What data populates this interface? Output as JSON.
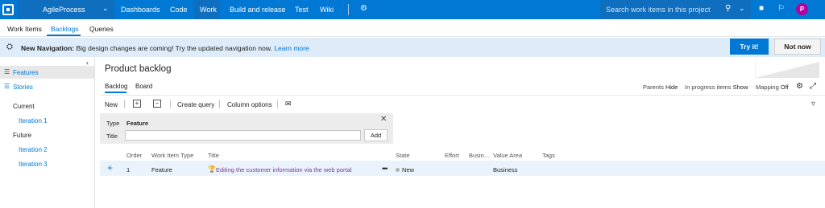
{
  "topbar": {
    "project": "AgileProcess",
    "nav": [
      "Dashboards",
      "Code",
      "Work",
      "Build and release",
      "Test",
      "Wiki"
    ],
    "active_nav": "Work",
    "search_placeholder": "Search work items in this project",
    "avatar_initial": "P",
    "colors": {
      "bar": "#0078d4",
      "active": "#106ebe",
      "avatar": "#b4009e"
    }
  },
  "subnav": {
    "tabs": [
      "Work Items",
      "Backlogs",
      "Queries"
    ],
    "active": "Backlogs"
  },
  "banner": {
    "title": "New Navigation:",
    "message": "Big design changes are coming! Try the updated navigation now.",
    "link": "Learn more",
    "try_label": "Try it!",
    "notnow_label": "Not now"
  },
  "sidebar": {
    "items": [
      {
        "label": "Features",
        "icon": "features-icon",
        "selected": true
      },
      {
        "label": "Stories",
        "icon": "stories-icon",
        "selected": false
      }
    ],
    "current_label": "Current",
    "current_iterations": [
      "Iteration 1"
    ],
    "future_label": "Future",
    "future_iterations": [
      "Iteration 2",
      "Iteration 3"
    ]
  },
  "main": {
    "title": "Product backlog",
    "tabs": [
      "Backlog",
      "Board"
    ],
    "active_tab": "Backlog",
    "options": {
      "parents_label": "Parents",
      "parents_value": "Hide",
      "inprogress_label": "In progress items",
      "inprogress_value": "Show",
      "mapping_label": "Mapping",
      "mapping_value": "Off"
    },
    "toolbar": {
      "new_label": "New",
      "create_query_label": "Create query",
      "column_options_label": "Column options"
    },
    "add_panel": {
      "type_label": "Type",
      "type_value": "Feature",
      "title_label": "Title",
      "title_value": "",
      "add_label": "Add"
    },
    "grid": {
      "columns": [
        "Order",
        "Work Item Type",
        "Title",
        "State",
        "Effort",
        "Busin…",
        "Value Area",
        "Tags"
      ],
      "rows": [
        {
          "order": "1",
          "type": "Feature",
          "title": "Editing the customer information via the web portal",
          "state": "New",
          "effort": "",
          "business": "",
          "value_area": "Business",
          "tags": ""
        }
      ]
    }
  }
}
